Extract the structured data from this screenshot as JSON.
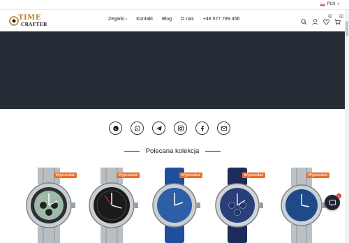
{
  "topbar": {
    "language": "PLN"
  },
  "brand": {
    "line1": "TIME",
    "line2": "CRAFTER"
  },
  "nav": {
    "items": [
      "Zegarki",
      "Kontakt",
      "Blog",
      "O nas",
      "+48 577 789 456"
    ]
  },
  "header_icons": {
    "wishlist_count": "0",
    "cart_count": "0"
  },
  "social": [
    "instagram-like-icon",
    "whatsapp-icon",
    "telegram-icon",
    "instagram-icon",
    "facebook-icon",
    "email-icon"
  ],
  "section": {
    "title": "Polecana kolekcja"
  },
  "products": [
    {
      "badge": "Wyprzedaż",
      "dial": "#9fb9a8",
      "strap": "steel"
    },
    {
      "badge": "Wyprzedaż",
      "dial": "#1b1b1b",
      "strap": "steel"
    },
    {
      "badge": "Wyprzedaż",
      "dial": "#2d5fa6",
      "strap": "blue"
    },
    {
      "badge": "Wyprzedaż",
      "dial": "#2a3f7a",
      "strap": "navy"
    },
    {
      "badge": "Wyprzedaż",
      "dial": "#1e4a8a",
      "strap": "steel"
    }
  ],
  "colors": {
    "hero": "#272d37",
    "accent": "#ee6e2a",
    "brand_gold": "#b8842e"
  },
  "chat": {
    "unread": "1"
  }
}
